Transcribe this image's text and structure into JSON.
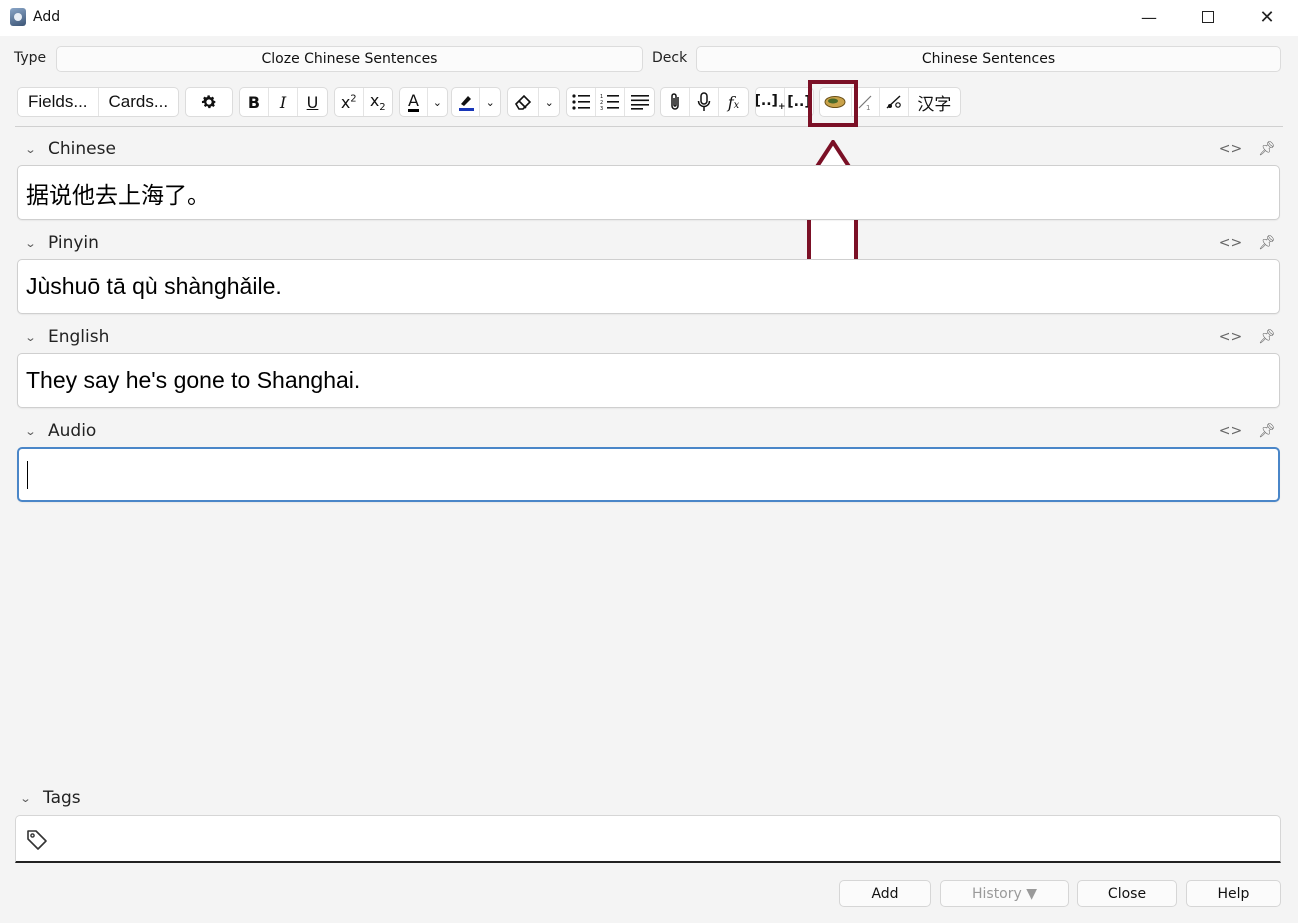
{
  "window": {
    "title": "Add"
  },
  "note_type": {
    "label": "Type",
    "value": "Cloze Chinese Sentences"
  },
  "deck": {
    "label": "Deck",
    "value": "Chinese Sentences"
  },
  "toolbar": {
    "fields_label": "Fields...",
    "cards_label": "Cards...",
    "hanzi_label": "汉字"
  },
  "fields": [
    {
      "name": "Chinese",
      "value": "据说他去上海了。"
    },
    {
      "name": "Pinyin",
      "value": "Jùshuō tā qù shànghǎile."
    },
    {
      "name": "English",
      "value": "They say he's gone to Shanghai."
    },
    {
      "name": "Audio",
      "value": ""
    }
  ],
  "tags": {
    "label": "Tags"
  },
  "buttons": {
    "add": "Add",
    "history": "History ▼",
    "close": "Close",
    "help": "Help"
  },
  "colors": {
    "highlight": "#7b1026",
    "focus": "#4a86c8"
  }
}
